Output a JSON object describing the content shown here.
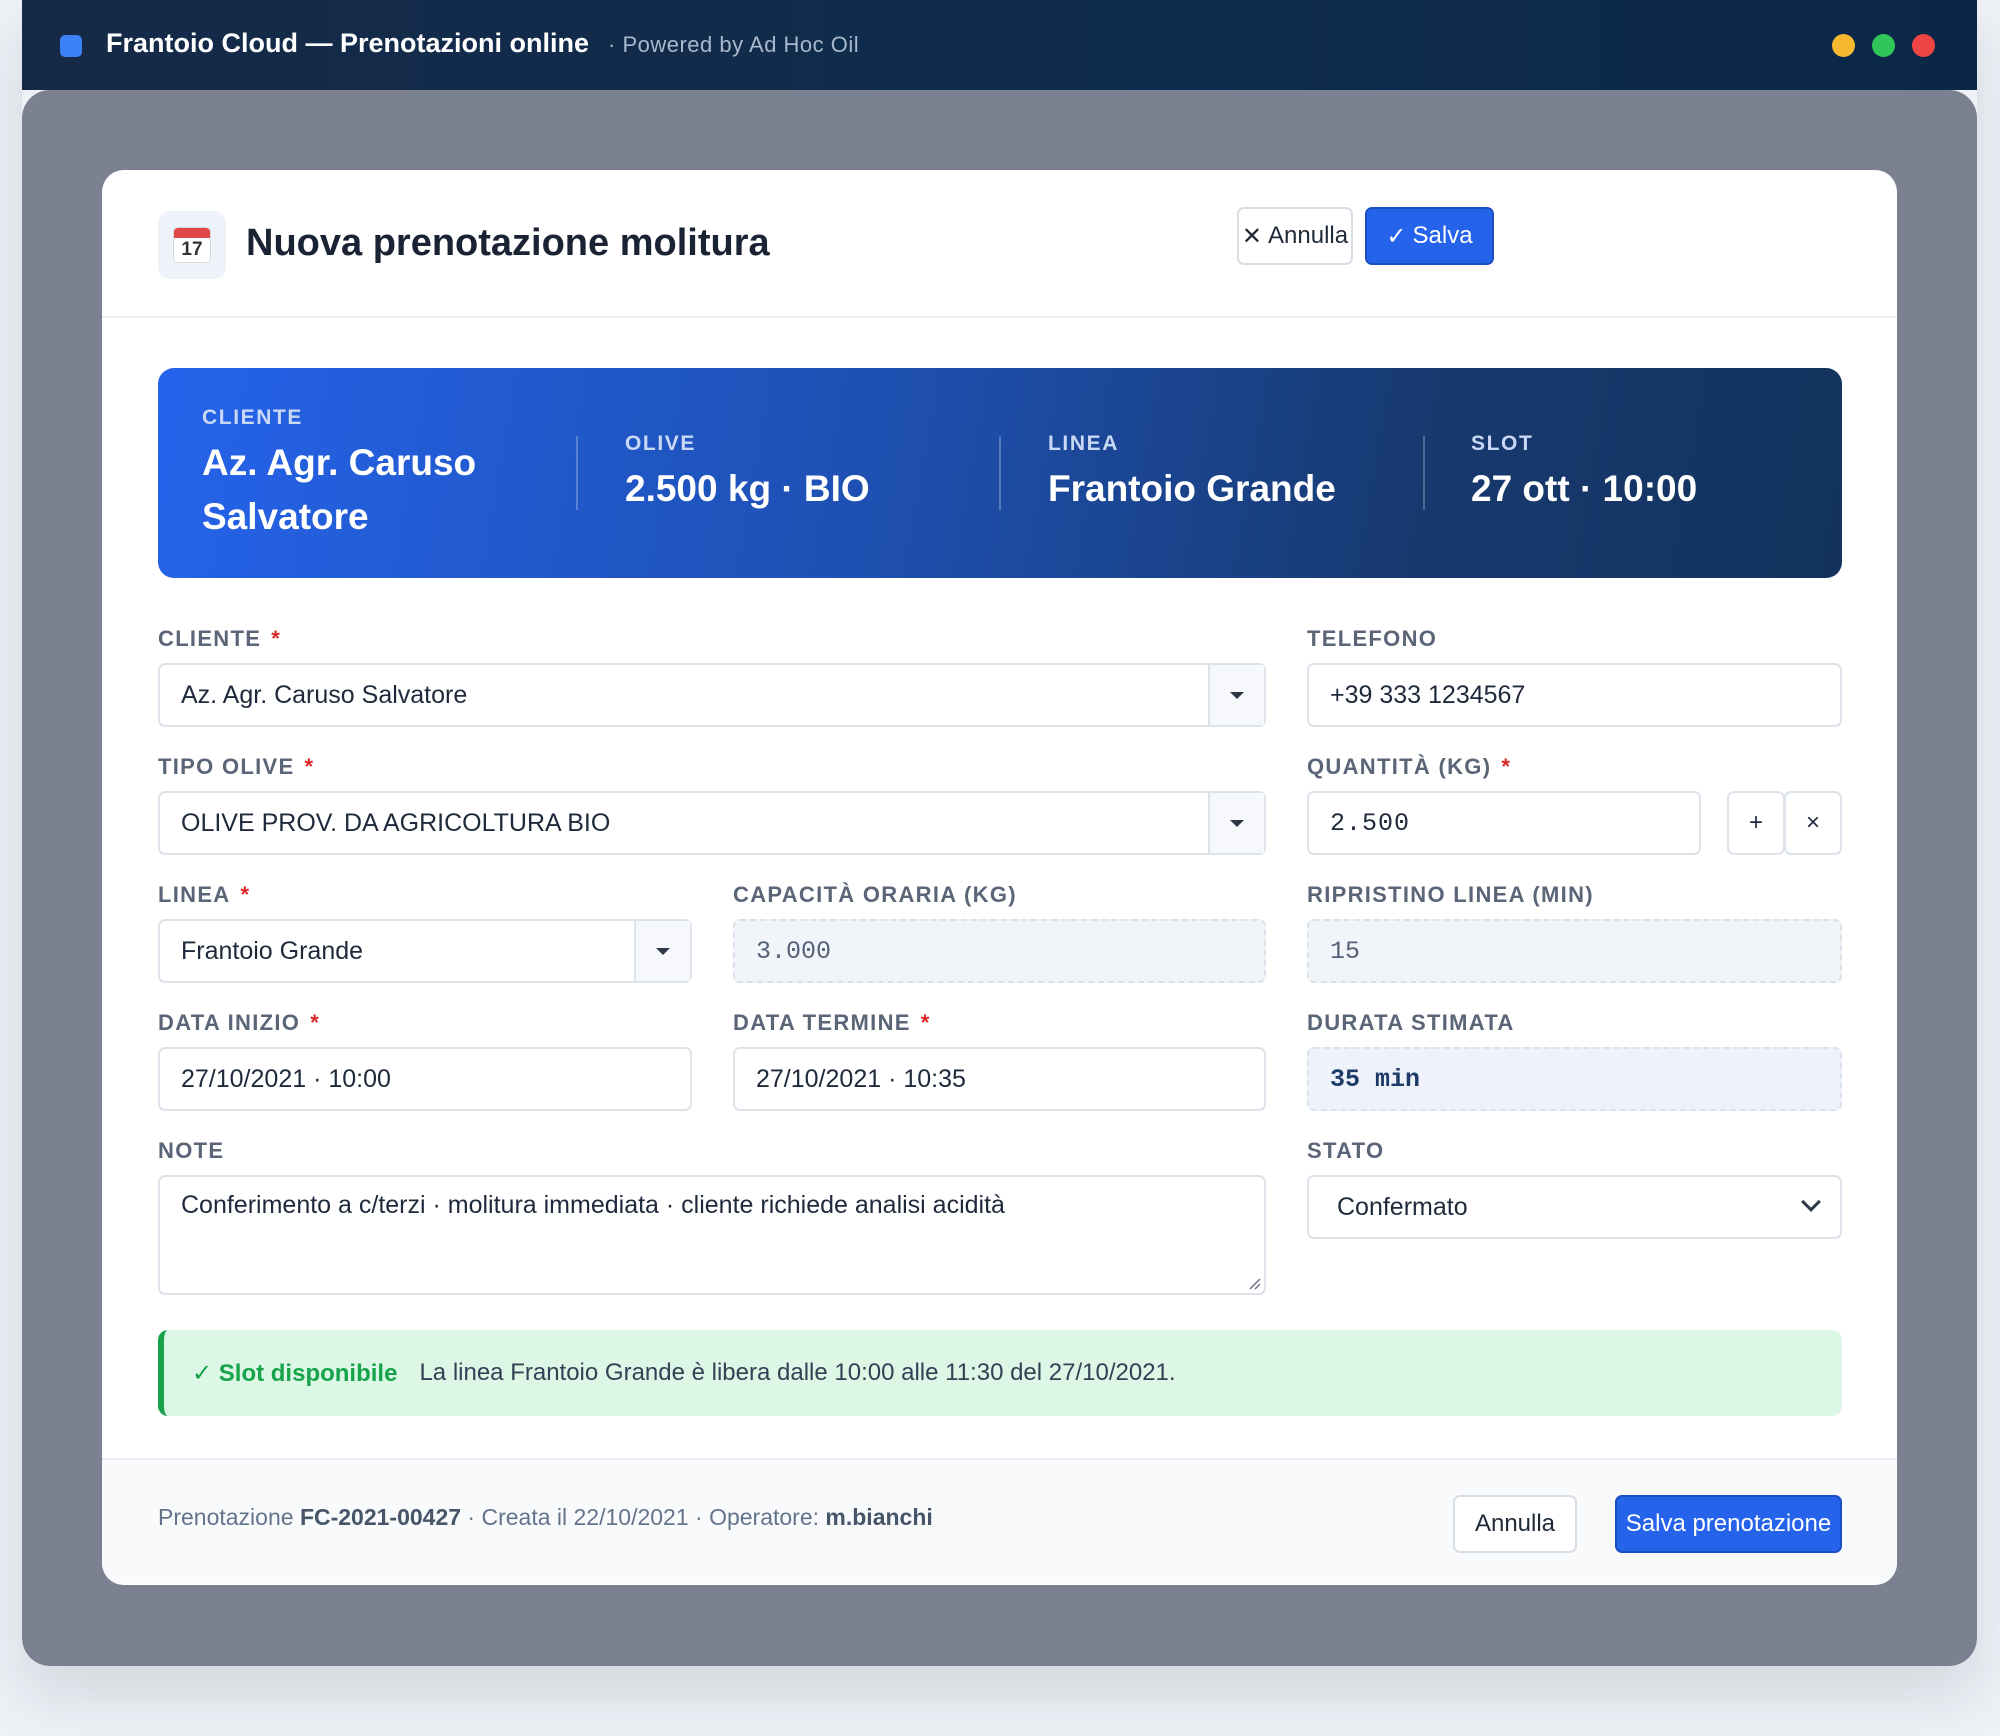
{
  "window": {
    "title": "Frantoio Cloud — Prenotazioni online",
    "subtitle": "· Powered by Ad Hoc Oil",
    "controls": [
      "minimize",
      "maximize",
      "close"
    ]
  },
  "dialog": {
    "icon": "calendar-icon",
    "icon_day": "17",
    "title": "Nuova prenotazione molitura",
    "cancel_label": "Annulla",
    "save_label": "Salva"
  },
  "summary": {
    "cliente_label": "CLIENTE",
    "cliente_value": "Az. Agr. Caruso Salvatore",
    "olive_label": "OLIVE",
    "olive_value": "2.500 kg · BIO",
    "linea_label": "LINEA",
    "linea_value": "Frantoio Grande",
    "slot_label": "SLOT",
    "slot_value": "27 ott · 10:00"
  },
  "form": {
    "cliente": {
      "label": "CLIENTE",
      "required": "*",
      "value": "Az. Agr. Caruso Salvatore"
    },
    "telefono": {
      "label": "TELEFONO",
      "value": "+39 333 1234567"
    },
    "tipo_olive": {
      "label": "TIPO OLIVE",
      "required": "*",
      "value": "OLIVE PROV. DA AGRICOLTURA BIO"
    },
    "quantita": {
      "label": "QUANTITÀ (KG)",
      "required": "*",
      "value": "2.500",
      "plus": "+",
      "clear": "×"
    },
    "linea": {
      "label": "LINEA",
      "required": "*",
      "value": "Frantoio Grande"
    },
    "capacita": {
      "label": "CAPACITÀ ORARIA (KG)",
      "value": "3.000"
    },
    "ripristino": {
      "label": "RIPRISTINO LINEA (MIN)",
      "value": "15"
    },
    "data_inizio": {
      "label": "DATA INIZIO",
      "required": "*",
      "value": "27/10/2021 · 10:00"
    },
    "data_termine": {
      "label": "DATA TERMINE",
      "required": "*",
      "value": "27/10/2021 · 10:35"
    },
    "durata": {
      "label": "DURATA STIMATA",
      "value": "35 min"
    },
    "note": {
      "label": "NOTE",
      "value": "Conferimento a c/terzi · molitura immediata · cliente richiede analisi acidità"
    },
    "stato": {
      "label": "STATO",
      "value": "Confermato"
    }
  },
  "alert": {
    "title": "✓ Slot disponibile",
    "text": "La linea Frantoio Grande è libera dalle 10:00 alle 11:30 del 27/10/2021."
  },
  "footer": {
    "prefix": "Prenotazione ",
    "booking_id": "FC-2021-00427",
    "middle": " · Creata il 22/10/2021 · Operatore: ",
    "operator": "m.bianchi",
    "cancel_label": "Annulla",
    "save_label": "Salva prenotazione"
  },
  "colors": {
    "accent": "#2563eb",
    "titlebar": "#0e2c4d",
    "success": "#16a34a",
    "required": "#dc2626"
  }
}
